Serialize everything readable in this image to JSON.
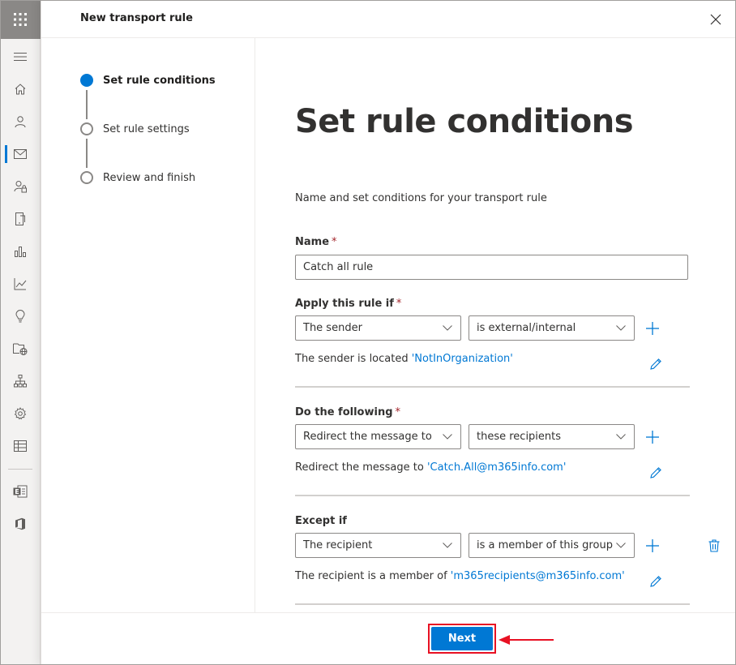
{
  "panel": {
    "title": "New transport rule",
    "close_icon": "close-icon"
  },
  "rail": {
    "icons": [
      "app-launcher-icon",
      "menu-icon",
      "home-icon",
      "person-icon",
      "mail-icon",
      "user-lock-icon",
      "mobile-icon",
      "reports-icon",
      "insights-icon",
      "lightbulb-icon",
      "public-folder-icon",
      "organization-icon",
      "settings-icon",
      "table-icon",
      "exchange-icon",
      "office-icon"
    ],
    "active_color": "#0078d4"
  },
  "steps": [
    {
      "label": "Set rule conditions",
      "state": "active"
    },
    {
      "label": "Set rule settings",
      "state": "pending"
    },
    {
      "label": "Review and finish",
      "state": "pending"
    }
  ],
  "content": {
    "title": "Set rule conditions",
    "description": "Name and set conditions for your transport rule",
    "name_label": "Name",
    "required_mark": "*",
    "name_value": "Catch all rule",
    "apply": {
      "label": "Apply this rule if",
      "dropdown1": "The sender",
      "dropdown2": "is external/internal",
      "summary_prefix": "The sender is located ",
      "summary_link": "'NotInOrganization'"
    },
    "do": {
      "label": "Do the following",
      "dropdown1": "Redirect the message to",
      "dropdown2": "these recipients",
      "summary_prefix": "Redirect the message to ",
      "summary_link": "'Catch.All@m365info.com'"
    },
    "except": {
      "label": "Except if",
      "dropdown1": "The recipient",
      "dropdown2": "is a member of this group",
      "summary_prefix": "The recipient is a member of ",
      "summary_link": "'m365recipients@m365info.com'"
    }
  },
  "footer": {
    "next_label": "Next",
    "highlight_color": "#e81123"
  },
  "colors": {
    "accent": "#0078d4",
    "required": "#a4262c"
  }
}
